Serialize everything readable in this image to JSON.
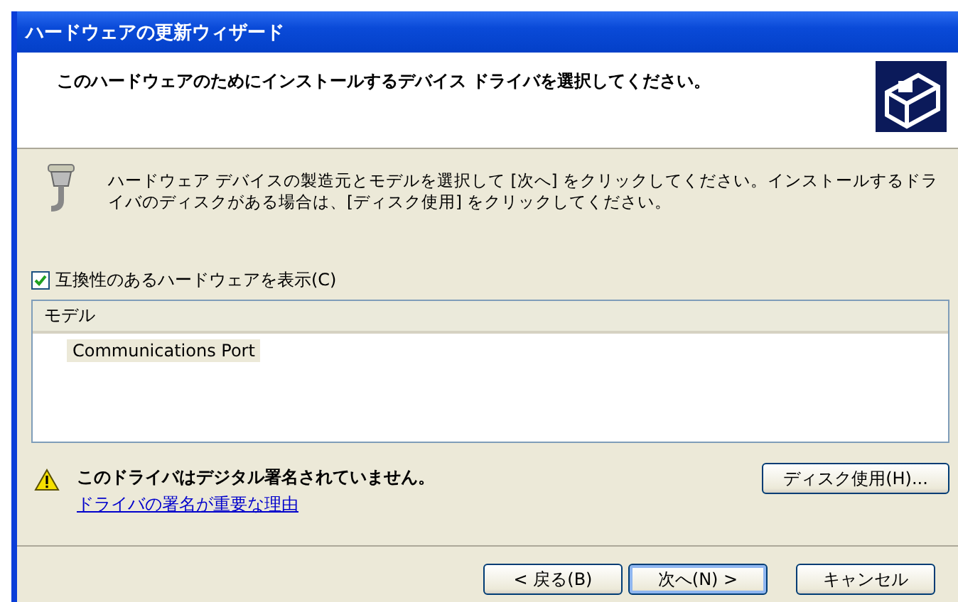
{
  "window": {
    "title": "ハードウェアの更新ウィザード"
  },
  "header": {
    "heading": "このハードウェアのためにインストールするデバイス ドライバを選択してください。"
  },
  "instructions": "ハードウェア デバイスの製造元とモデルを選択して [次へ] をクリックしてください。インストールするドライバのディスクがある場合は、[ディスク使用] をクリックしてください。",
  "compatible_checkbox": {
    "label": "互換性のあるハードウェアを表示(C)",
    "checked": true
  },
  "model_list": {
    "column": "モデル",
    "items": [
      {
        "label": "Communications Port",
        "selected": true
      }
    ]
  },
  "warning": {
    "message": "このドライバはデジタル署名されていません。",
    "link": "ドライバの署名が重要な理由"
  },
  "have_disk_button": "ディスク使用(H)...",
  "buttons": [
    {
      "label": "< 戻る(B)",
      "default": false
    },
    {
      "label": "次へ(N) >",
      "default": true
    },
    {
      "label": "キャンセル",
      "default": false
    }
  ]
}
